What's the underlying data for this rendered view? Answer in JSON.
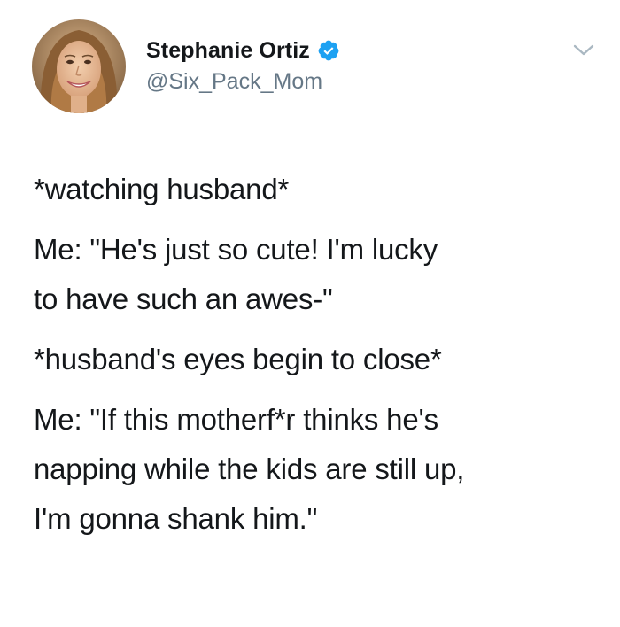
{
  "tweet": {
    "author": {
      "display_name": "Stephanie Ortiz",
      "handle": "@Six_Pack_Mom",
      "verified": true,
      "verified_icon": "verified-badge-icon",
      "avatar_icon": "profile-photo"
    },
    "menu_icon": "chevron-down-icon",
    "lines": [
      "*watching husband*",
      "Me: \"He's just so cute! I'm lucky",
      "to have such an awes-\"",
      "*husband's eyes begin to close*",
      "Me: \"If this motherf*r thinks he's",
      "napping while the kids are still up,",
      "I'm gonna shank him.\""
    ]
  },
  "colors": {
    "text": "#14171a",
    "handle": "#657786",
    "verified_blue": "#1da1f2",
    "caret": "#aab8c2"
  }
}
